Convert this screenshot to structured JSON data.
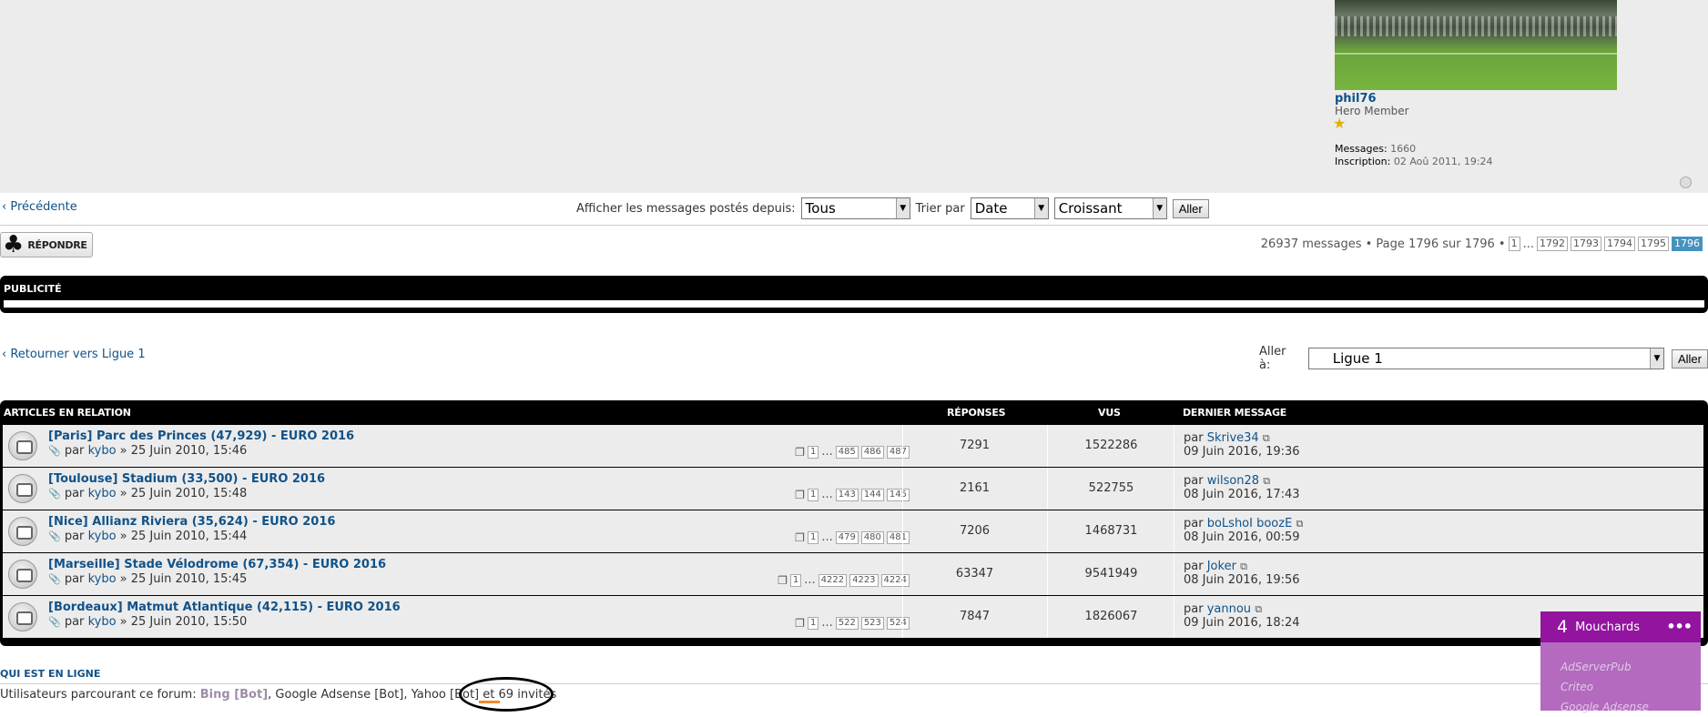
{
  "post": {
    "author": "phil76",
    "rank": "Hero Member",
    "messages_label": "Messages:",
    "messages_value": "1660",
    "registered_label": "Inscription:",
    "registered_value": "02 Aoû 2011, 19:24"
  },
  "sortbar": {
    "prev": "‹ Précédente",
    "show_label": "Afficher les messages postés depuis:",
    "show_value": "Tous",
    "sort_label": "Trier par",
    "sort_value": "Date",
    "order_value": "Croissant",
    "go": "Aller"
  },
  "reply": {
    "label": "RÉPONDRE"
  },
  "pagination": {
    "summary": "26937 messages • Page 1796 sur 1796 •",
    "first": "1",
    "ellipsis": "...",
    "pages": [
      "1792",
      "1793",
      "1794",
      "1795"
    ],
    "current": "1796"
  },
  "pub": {
    "label": "PUBLICITÉ"
  },
  "nav": {
    "back": "‹ Retourner vers Ligue 1",
    "jump_label": "Aller à:",
    "jump_value": "Ligue 1",
    "jump_go": "Aller"
  },
  "related": {
    "headers": {
      "articles": "ARTICLES EN RELATION",
      "replies": "RÉPONSES",
      "views": "VUS",
      "last": "DERNIER MESSAGE"
    },
    "rows": [
      {
        "title": "[Paris] Parc des Princes (47,929) - EURO 2016",
        "by": "par",
        "author": "kybo",
        "date": "» 25 Juin 2010, 15:46",
        "pages": [
          "1",
          "...",
          "485",
          "486",
          "487"
        ],
        "replies": "7291",
        "views": "1522286",
        "last_by": "par",
        "last_author": "Skrive34",
        "last_date": "09 Juin 2016, 19:36"
      },
      {
        "title": "[Toulouse] Stadium (33,500) - EURO 2016",
        "by": "par",
        "author": "kybo",
        "date": "» 25 Juin 2010, 15:48",
        "pages": [
          "1",
          "...",
          "143",
          "144",
          "145"
        ],
        "replies": "2161",
        "views": "522755",
        "last_by": "par",
        "last_author": "wilson28",
        "last_date": "08 Juin 2016, 17:43"
      },
      {
        "title": "[Nice] Allianz Riviera (35,624) - EURO 2016",
        "by": "par",
        "author": "kybo",
        "date": "» 25 Juin 2010, 15:44",
        "pages": [
          "1",
          "...",
          "479",
          "480",
          "481"
        ],
        "replies": "7206",
        "views": "1468731",
        "last_by": "par",
        "last_author": "boLshoI boozE",
        "last_date": "08 Juin 2016, 00:59"
      },
      {
        "title": "[Marseille] Stade Vélodrome (67,354) - EURO 2016",
        "by": "par",
        "author": "kybo",
        "date": "» 25 Juin 2010, 15:45",
        "pages": [
          "1",
          "...",
          "4222",
          "4223",
          "4224"
        ],
        "replies": "63347",
        "views": "9541949",
        "last_by": "par",
        "last_author": "Joker",
        "last_date": "08 Juin 2016, 19:56"
      },
      {
        "title": "[Bordeaux] Matmut Atlantique (42,115) - EURO 2016",
        "by": "par",
        "author": "kybo",
        "date": "» 25 Juin 2010, 15:50",
        "pages": [
          "1",
          "...",
          "522",
          "523",
          "524"
        ],
        "replies": "7847",
        "views": "1826067",
        "last_by": "par",
        "last_author": "yannou",
        "last_date": "09 Juin 2016, 18:24"
      }
    ]
  },
  "online": {
    "title": "QUI EST EN LIGNE",
    "prefix": "Utilisateurs parcourant ce forum:",
    "bot1": "Bing [Bot]",
    "sep1": ",",
    "bot2": "Google Adsense [Bot]",
    "sep2": ",",
    "bot3": "Yahoo [Bot]",
    "et": "et",
    "guests_count": "69",
    "guests_label": "invités"
  },
  "mouchards": {
    "count": "4",
    "title": "Mouchards",
    "menu": "•••",
    "items": [
      "AdServerPub",
      "Criteo",
      "Google Adsense"
    ]
  },
  "colors": {
    "link": "#105289",
    "active_page": "#4692bf",
    "widget_head": "#93149f",
    "widget_body": "#b36abf"
  }
}
